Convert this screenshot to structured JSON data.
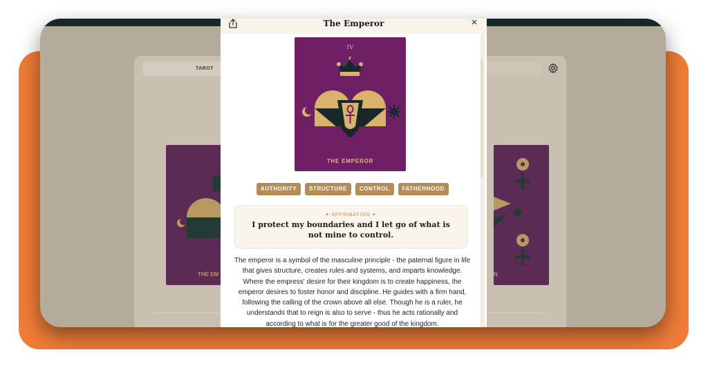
{
  "background_tab": {
    "label": "TAROT"
  },
  "modal": {
    "title": "The Emperor",
    "share_icon": "share-icon",
    "close_icon": "close-icon",
    "close_glyph": "×"
  },
  "card": {
    "numeral": "IV",
    "name": "THE EMPEROR",
    "colors": {
      "background": "#6f1f64",
      "gold": "#d9b36d",
      "dark": "#17282a"
    }
  },
  "tags": [
    "AUTHORITY",
    "STRUCTURE",
    "CONTROL",
    "FATHERHOOD"
  ],
  "affirmation": {
    "label": "✦ AFFIRMATION ✦",
    "text": "I protect my boundaries and I let go of what is not mine to control."
  },
  "description": "The emperor is a symbol of the masculine principle - the paternal figure in life that gives structure, creates rules and systems, and imparts knowledge. Where the empress' desire for their kingdom is to create happiness, the emperor desires to foster honor and discipline. He guides with a firm hand, following the calling of the crown above all else. Though he is a ruler, he understands that to reign is also to serve - thus he acts rationally and according to what is for the greater good of the kingdom.",
  "colors": {
    "accent": "#ef7d38",
    "tag": "#b58c55"
  }
}
